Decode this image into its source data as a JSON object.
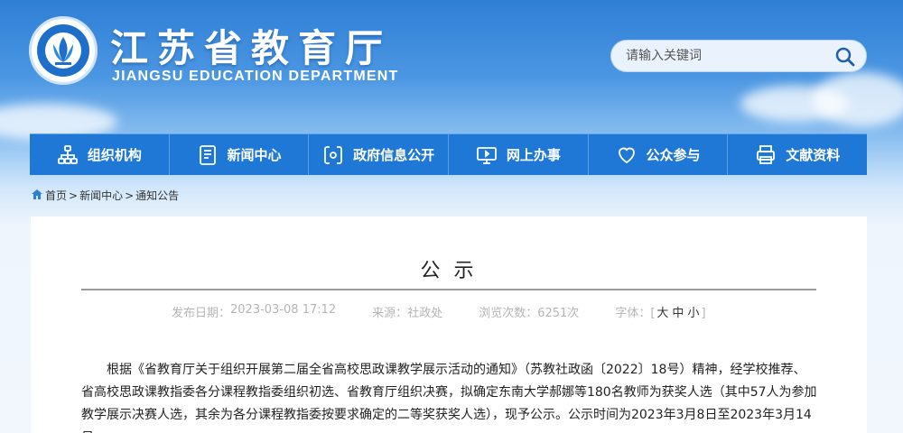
{
  "header": {
    "title_cn": "江苏省教育厅",
    "title_en": "JIANGSU EDUCATION DEPARTMENT",
    "search_placeholder": "请输入关键词"
  },
  "nav": {
    "items": [
      {
        "label": "组织机构",
        "icon": "org-chart-icon"
      },
      {
        "label": "新闻中心",
        "icon": "document-icon"
      },
      {
        "label": "政府信息公开",
        "icon": "disclosure-icon"
      },
      {
        "label": "网上办事",
        "icon": "monitor-icon"
      },
      {
        "label": "公众参与",
        "icon": "heart-icon"
      },
      {
        "label": "文献资料",
        "icon": "printer-icon"
      }
    ]
  },
  "breadcrumb": {
    "items": [
      "首页",
      "新闻中心",
      "通知公告"
    ],
    "separator": ">"
  },
  "article": {
    "title": "公 示",
    "meta": {
      "date_label": "发布日期：",
      "date": "2023-03-08 17:12",
      "source_label": "来源：",
      "source": "社政处",
      "views_label": "浏览次数：",
      "views": "6251次",
      "font_label": "字体：",
      "font_sizes": [
        "大",
        "中",
        "小"
      ]
    },
    "body": "根据《省教育厅关于组织开展第二届全省高校思政课教学展示活动的通知》（苏教社政函〔2022〕18号）精神，经学校推荐、省高校思政课教指委各分课程教指委组织初选、省教育厅组织决赛，拟确定东南大学郝娜等180名教师为获奖人选（其中57人为参加教学展示决赛人选，其余为各分课程教指委按要求确定的二等奖获奖人选），现予公示。公示时间为2023年3月8日至2023年3月14日。"
  },
  "colors": {
    "nav_bg": "#1f78d6",
    "header_gradient_top": "#2f7fd6",
    "page_bg": "#f2f7fd"
  }
}
